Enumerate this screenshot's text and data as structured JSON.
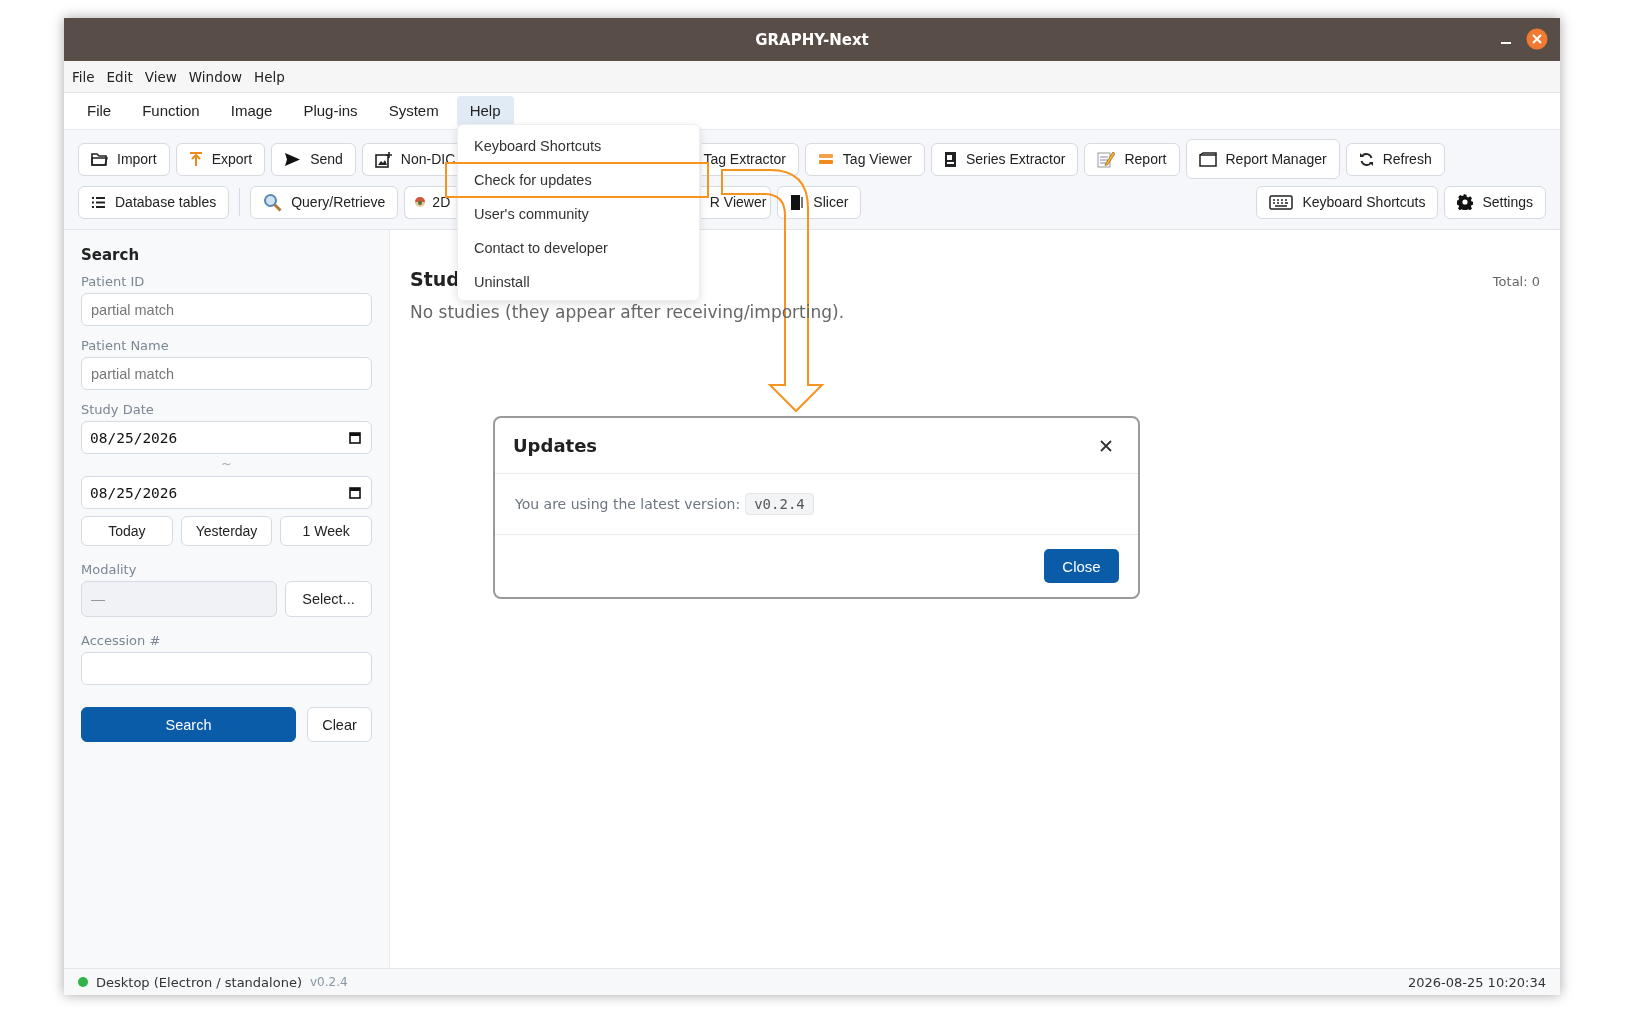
{
  "window": {
    "title": "GRAPHY-Next"
  },
  "native_menu": [
    "File",
    "Edit",
    "View",
    "Window",
    "Help"
  ],
  "app_menu": [
    {
      "label": "File",
      "selected": false
    },
    {
      "label": "Function",
      "selected": false
    },
    {
      "label": "Image",
      "selected": false
    },
    {
      "label": "Plug-ins",
      "selected": false
    },
    {
      "label": "System",
      "selected": false
    },
    {
      "label": "Help",
      "selected": true
    }
  ],
  "help_menu": [
    {
      "label": "Keyboard Shortcuts",
      "highlighted": false
    },
    {
      "label": "Check for updates",
      "highlighted": true
    },
    {
      "label": "User's community",
      "highlighted": false
    },
    {
      "label": "Contact to developer",
      "highlighted": false
    },
    {
      "label": "Uninstall",
      "highlighted": false
    }
  ],
  "toolbar_row_1": [
    {
      "label": "Import",
      "kind": "full"
    },
    {
      "label": "Export",
      "kind": "full"
    },
    {
      "label": "Send",
      "kind": "full"
    },
    {
      "label": "Non-DIC",
      "kind": "cut_right"
    },
    {
      "label": "Tag Extractor",
      "kind": "cut_left"
    },
    {
      "label": "Tag Viewer",
      "kind": "full"
    },
    {
      "label": "Series Extractor",
      "kind": "full"
    },
    {
      "label": "Report",
      "kind": "full"
    },
    {
      "label": "Report Manager",
      "kind": "full"
    },
    {
      "label": "Refresh",
      "kind": "full"
    }
  ],
  "toolbar_row_2_left": [
    {
      "label": "Database tables",
      "kind": "full"
    },
    {
      "label": "Query/Retrieve",
      "kind": "full"
    },
    {
      "label": "2D",
      "kind": "cut_right"
    },
    {
      "label": "R Viewer",
      "kind": "cut_left"
    },
    {
      "label": "Slicer",
      "kind": "full"
    }
  ],
  "toolbar_row_2_right": [
    {
      "label": "Keyboard Shortcuts"
    },
    {
      "label": "Settings"
    }
  ],
  "search_panel": {
    "title": "Search",
    "patient_id": {
      "label": "Patient ID",
      "placeholder": "partial match"
    },
    "patient_name": {
      "label": "Patient Name",
      "placeholder": "partial match"
    },
    "study_date": {
      "label": "Study Date",
      "from": "08/25/2026",
      "separator": "~",
      "to": "08/25/2026"
    },
    "date_buttons": [
      "Today",
      "Yesterday",
      "1 Week"
    ],
    "modality": {
      "label": "Modality",
      "value": "—",
      "disabled": true,
      "button": "Select..."
    },
    "accession": {
      "label": "Accession #"
    },
    "search_button": "Search",
    "clear_button": "Clear"
  },
  "studies": {
    "title": "Stud",
    "total": "Total: 0",
    "empty_message": "No studies (they appear after receiving/importing)."
  },
  "dialog": {
    "title": "Updates",
    "message": "You are using the latest version:",
    "version": "v0.2.4",
    "close_button": "Close"
  },
  "status_bar": {
    "connected": true,
    "mode": "Desktop (Electron / standalone)",
    "version": "v0.2.4",
    "datetime": "2026-08-25 10:20:34"
  }
}
